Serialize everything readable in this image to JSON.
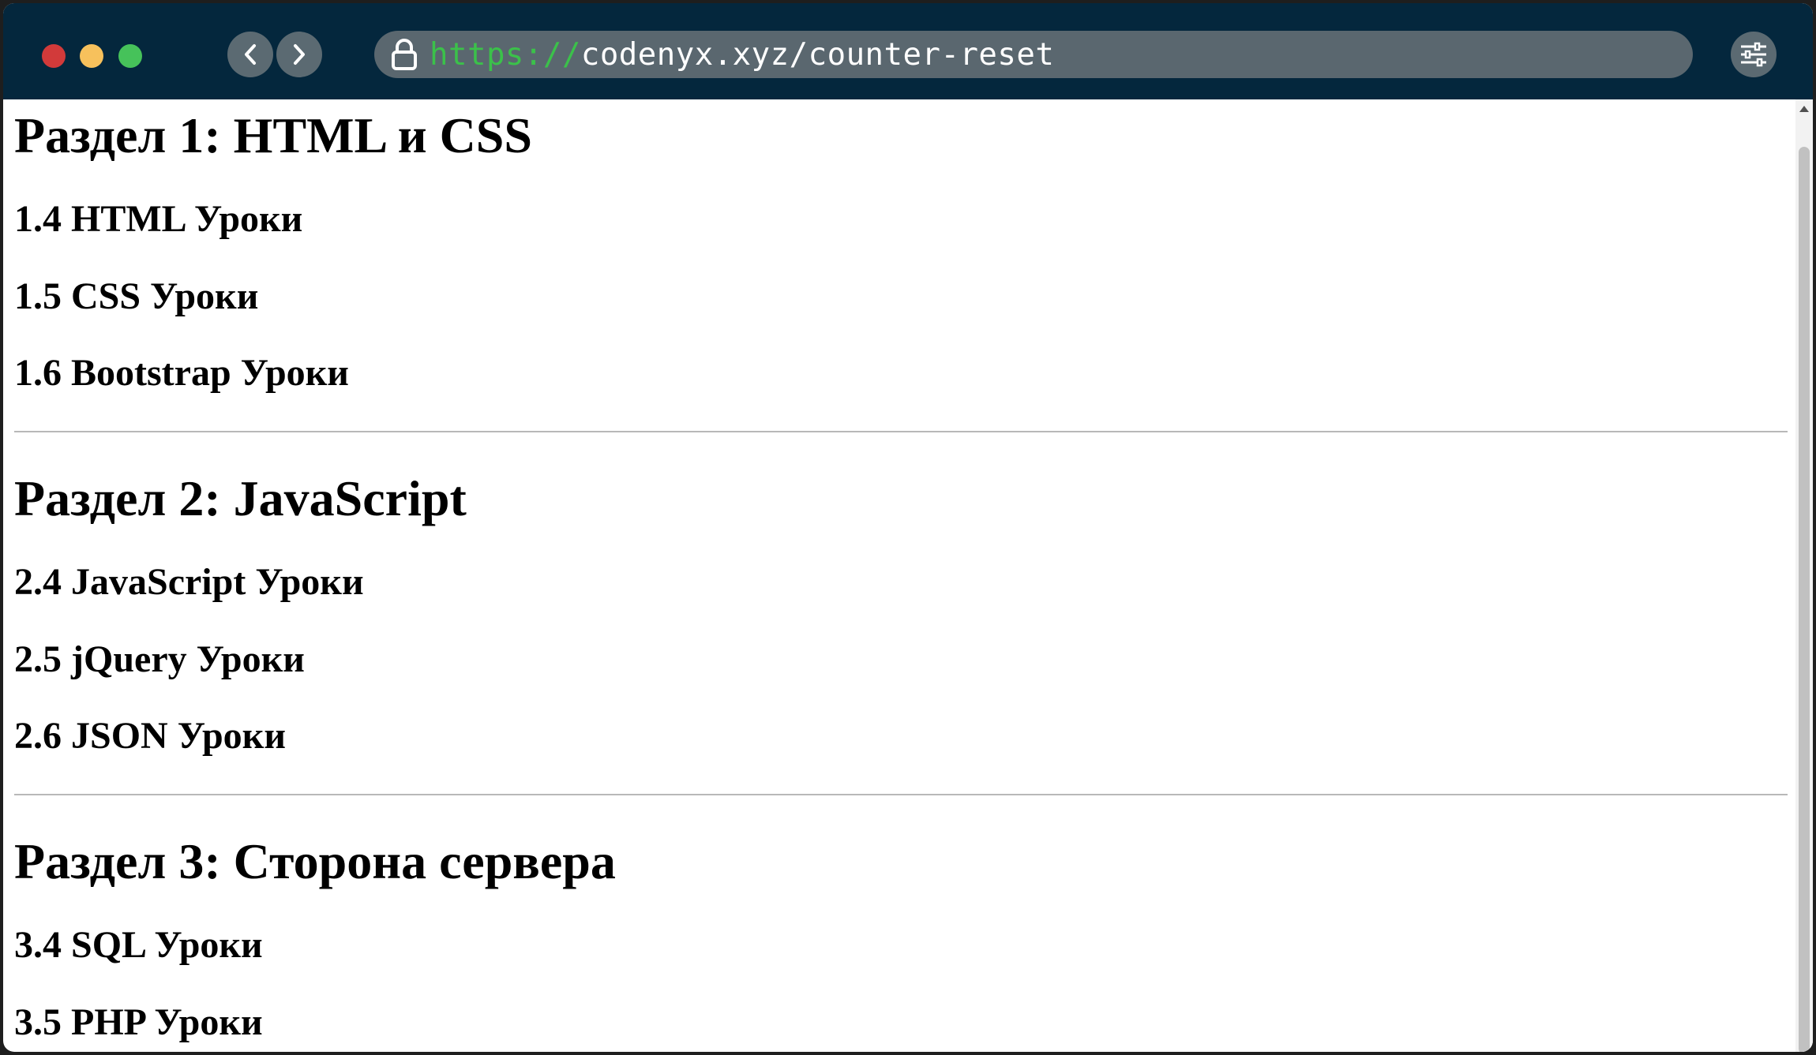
{
  "browser": {
    "url_scheme": "https://",
    "url_rest": "codenyx.xyz/counter-reset"
  },
  "page": {
    "sections": [
      {
        "title": "Раздел 1: HTML и CSS",
        "items": [
          "1.4 HTML Уроки",
          "1.5 CSS Уроки",
          "1.6 Bootstrap Уроки"
        ]
      },
      {
        "title": "Раздел 2: JavaScript",
        "items": [
          "2.4 JavaScript Уроки",
          "2.5 jQuery Уроки",
          "2.6 JSON Уроки"
        ]
      },
      {
        "title": "Раздел 3: Сторона сервера",
        "items": [
          "3.4 SQL Уроки",
          "3.5 PHP Уроки"
        ]
      }
    ]
  },
  "icons": {
    "close": "close-dot",
    "minimize": "minimize-dot",
    "maximize": "maximize-dot",
    "back": "chevron-left-icon",
    "forward": "chevron-right-icon",
    "lock": "lock-icon",
    "settings": "sliders-icon"
  },
  "colors": {
    "titlebar": "#04273d",
    "url_scheme": "#3bc14a",
    "close": "#d23a3a",
    "minimize": "#f7c15c",
    "maximize": "#46c25a"
  }
}
